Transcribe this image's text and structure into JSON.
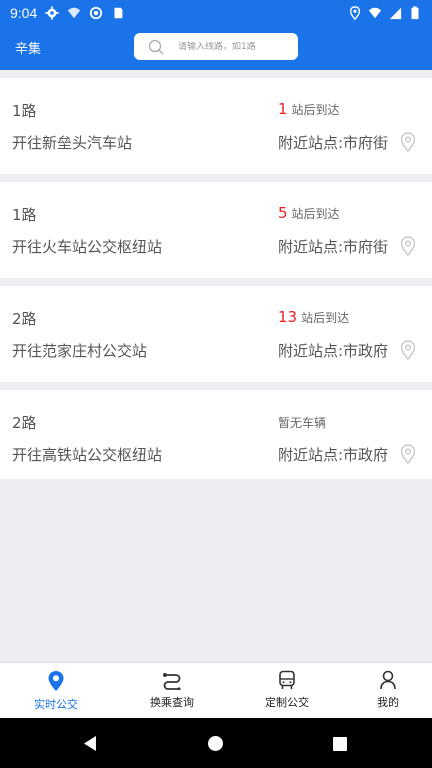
{
  "status_bar": {
    "time": "9:04"
  },
  "header": {
    "city": "辛集",
    "search_placeholder": "请输入线路，如1路"
  },
  "routes": [
    {
      "route": "1路",
      "destination": "开往新垒头汽车站",
      "arrival_num": "1",
      "arrival_suffix": "站后到达",
      "nearby": "附近站点:市府街"
    },
    {
      "route": "1路",
      "destination": "开往火车站公交枢纽站",
      "arrival_num": "5",
      "arrival_suffix": "站后到达",
      "nearby": "附近站点:市府街"
    },
    {
      "route": "2路",
      "destination": "开往范家庄村公交站",
      "arrival_num": "13",
      "arrival_suffix": "站后到达",
      "nearby": "附近站点:市政府"
    },
    {
      "route": "2路",
      "destination": "开往高铁站公交枢纽站",
      "no_bus": "暂无车辆",
      "nearby": "附近站点:市政府"
    }
  ],
  "bottom_nav": {
    "items": [
      {
        "label": "实时公交",
        "icon": "location-pin-icon",
        "active": true
      },
      {
        "label": "换乘查询",
        "icon": "transfer-route-icon"
      },
      {
        "label": "定制公交",
        "icon": "bus-icon"
      },
      {
        "label": "我的",
        "icon": "person-icon"
      }
    ]
  },
  "colors": {
    "brand": "#1a73e8",
    "arrival_red": "#e52222",
    "background": "#eeeef2"
  }
}
